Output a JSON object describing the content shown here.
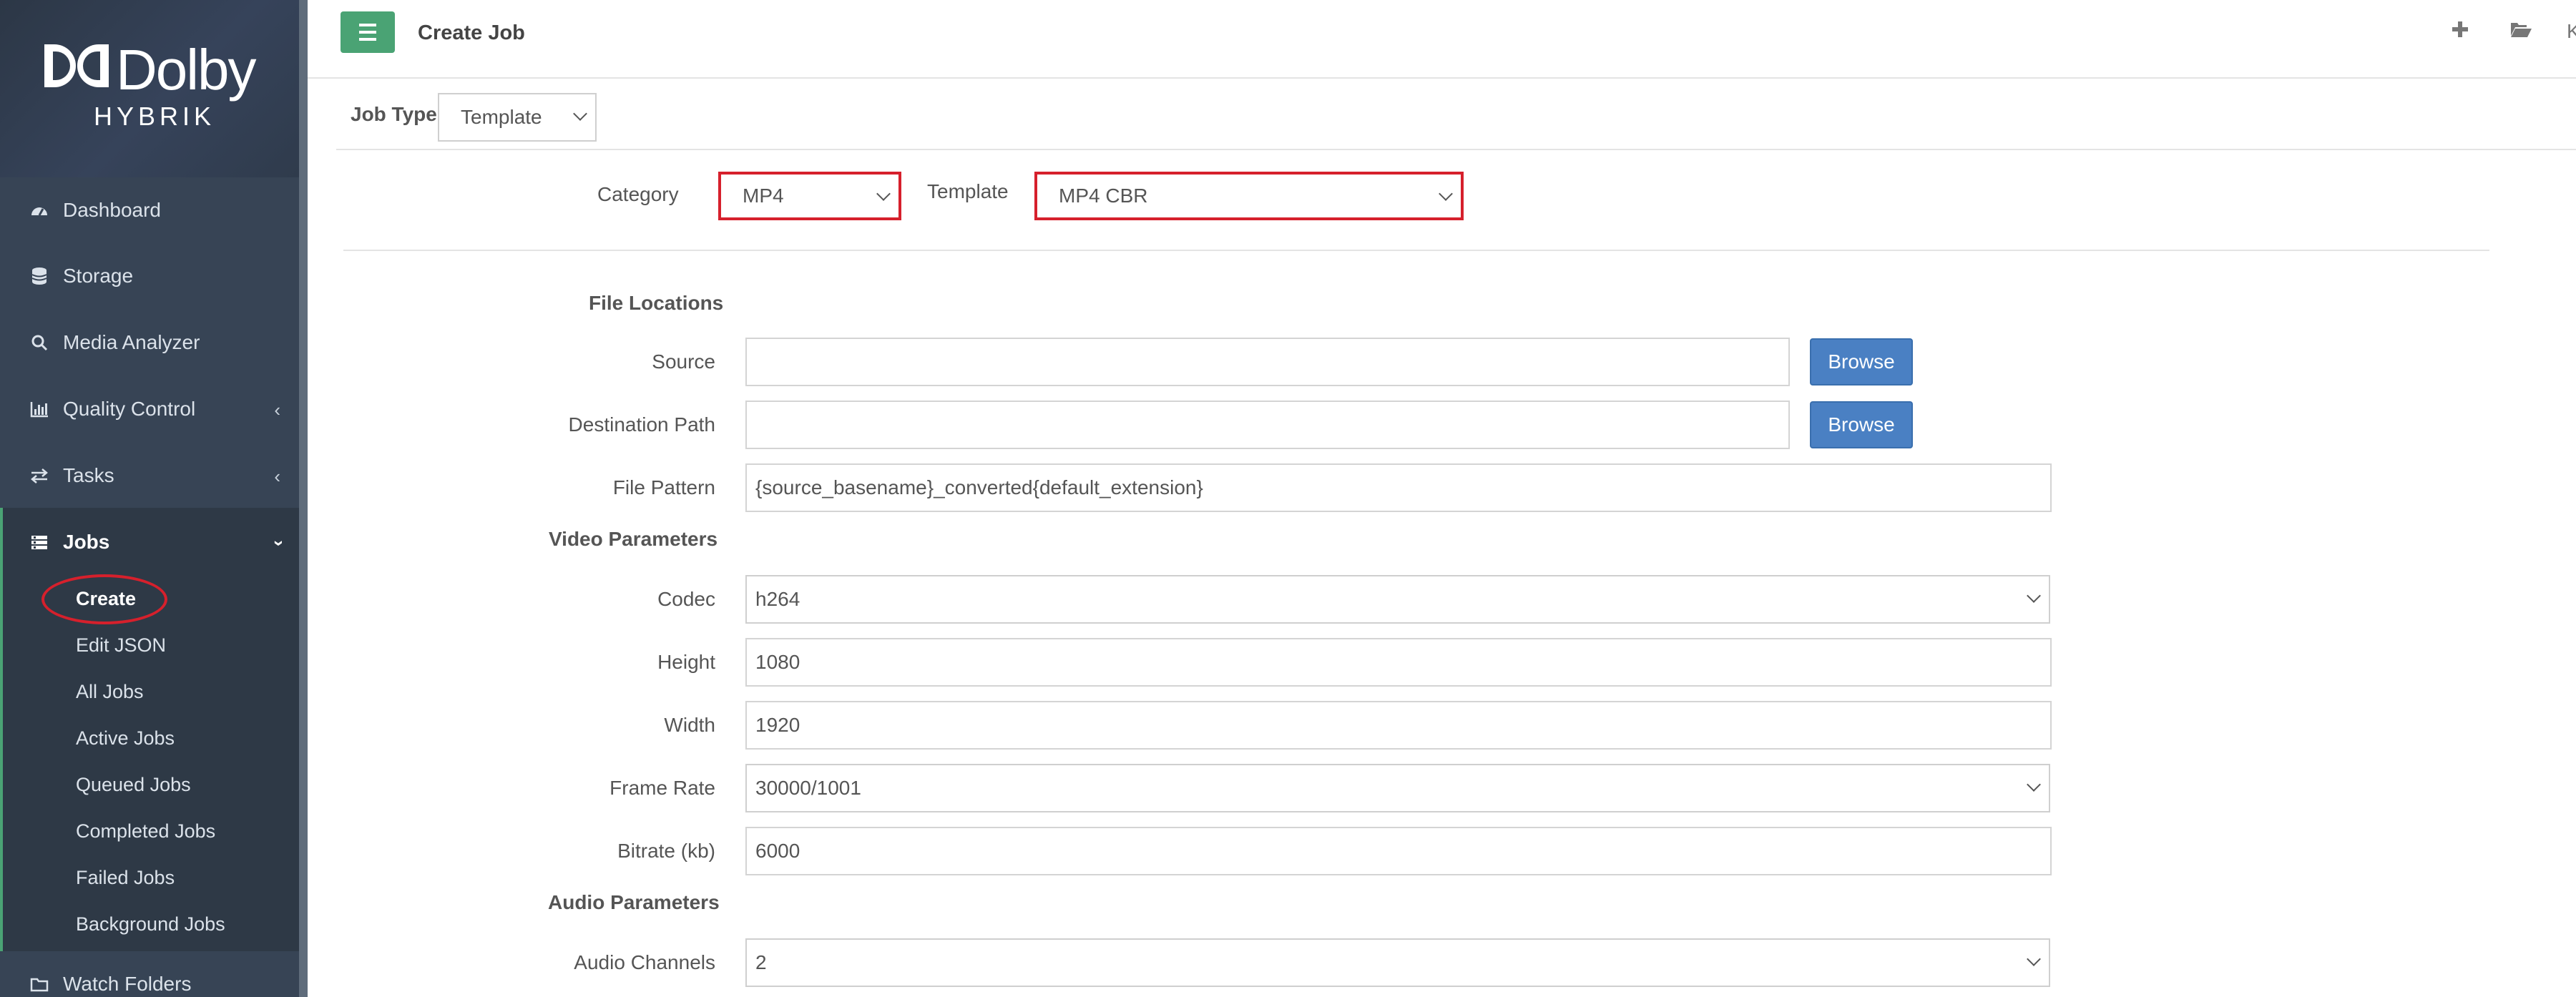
{
  "brand": {
    "name": "Dolby",
    "product": "HYBRIK"
  },
  "sidebar": {
    "items": [
      {
        "label": "Dashboard",
        "icon": "dashboard-icon"
      },
      {
        "label": "Storage",
        "icon": "database-icon"
      },
      {
        "label": "Media Analyzer",
        "icon": "search-icon"
      },
      {
        "label": "Quality Control",
        "icon": "bar-chart-icon"
      },
      {
        "label": "Tasks",
        "icon": "exchange-icon"
      },
      {
        "label": "Jobs",
        "icon": "list-icon"
      },
      {
        "label": "Watch Folders",
        "icon": "folder-icon"
      }
    ],
    "jobs_sub": [
      "Create",
      "Edit JSON",
      "All Jobs",
      "Active Jobs",
      "Queued Jobs",
      "Completed Jobs",
      "Failed Jobs",
      "Background Jobs"
    ]
  },
  "header": {
    "title": "Create Job",
    "user_initial": "K"
  },
  "form": {
    "job_type_label": "Job Type",
    "job_type_value": "Template",
    "category_label": "Category",
    "category_value": "MP4",
    "template_label": "Template",
    "template_value": "MP4 CBR",
    "file_locations_heading": "File Locations",
    "source_label": "Source",
    "source_value": "",
    "destination_label": "Destination Path",
    "destination_value": "",
    "browse_label": "Browse",
    "file_pattern_label": "File Pattern",
    "file_pattern_value": "{source_basename}_converted{default_extension}",
    "video_heading": "Video Parameters",
    "codec_label": "Codec",
    "codec_value": "h264",
    "height_label": "Height",
    "height_value": "1080",
    "width_label": "Width",
    "width_value": "1920",
    "frame_rate_label": "Frame Rate",
    "frame_rate_value": "30000/1001",
    "bitrate_label": "Bitrate (kb)",
    "bitrate_value": "6000",
    "audio_heading": "Audio Parameters",
    "audio_channels_label": "Audio Channels",
    "audio_channels_value": "2"
  },
  "colors": {
    "sidebar": "#374455",
    "accent_green": "#4aa374",
    "button_blue": "#4a80c3",
    "highlight_red": "#d6202c"
  }
}
